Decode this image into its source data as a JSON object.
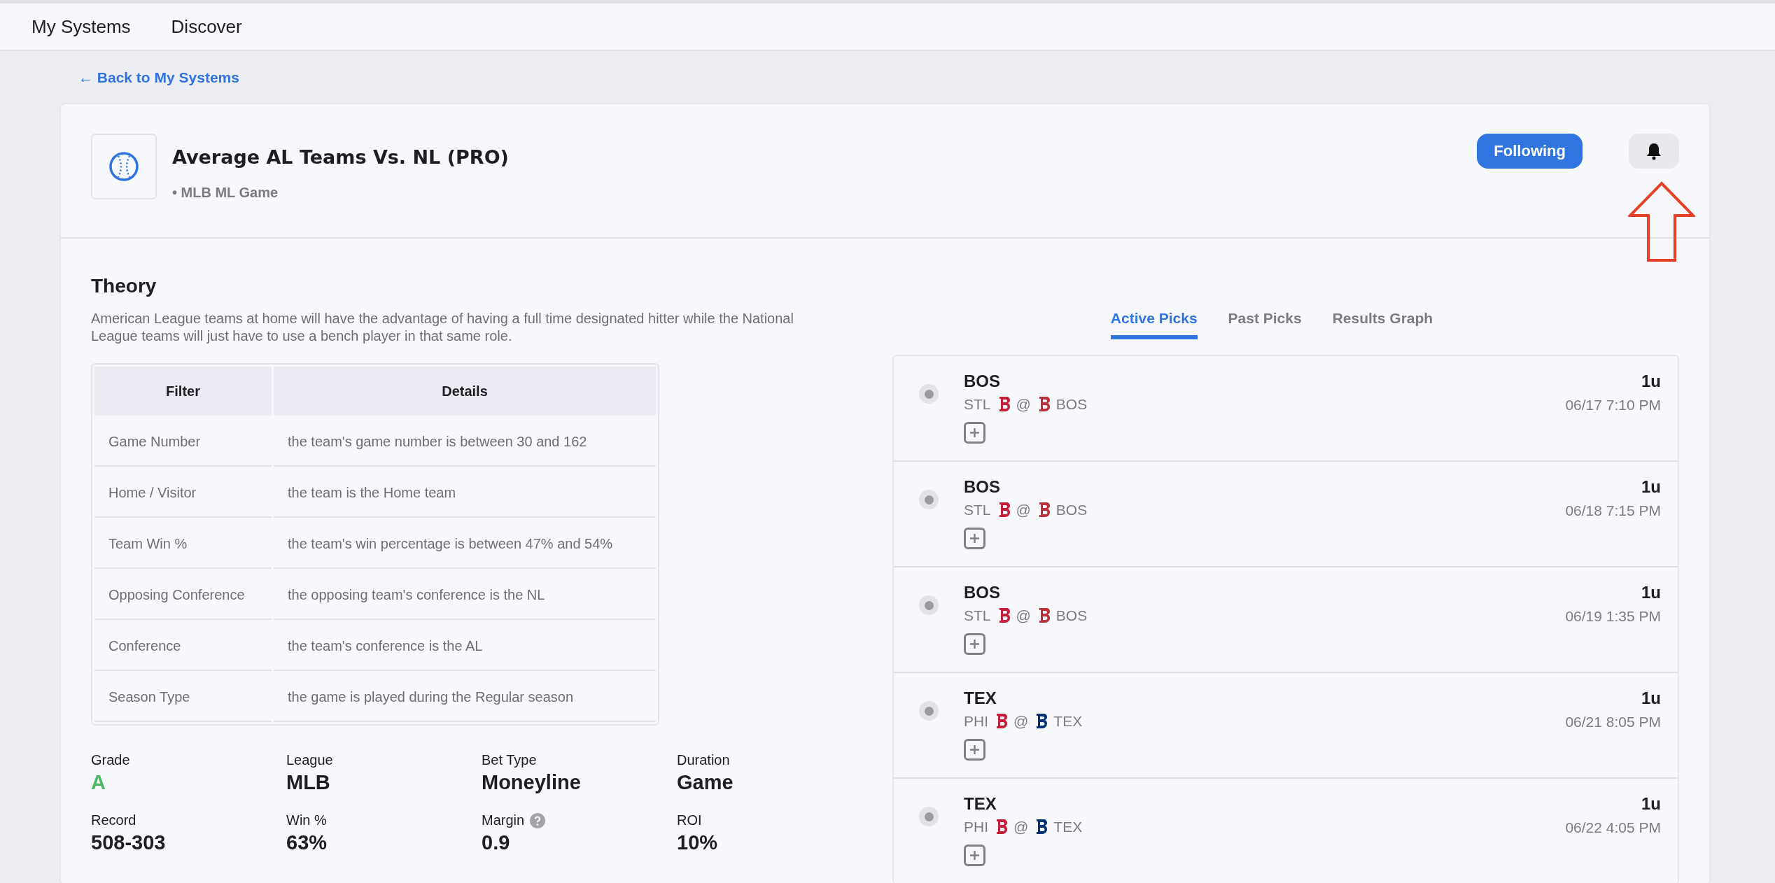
{
  "nav": {
    "items": [
      {
        "label": "My Systems"
      },
      {
        "label": "Discover"
      }
    ]
  },
  "back_link": "← Back to My Systems",
  "system": {
    "title": "Average AL Teams Vs. NL (PRO)",
    "subtitle": "• MLB ML Game",
    "follow_button": "Following",
    "following": true
  },
  "theory": {
    "heading": "Theory",
    "text": "American League teams at home will have the advantage of having a full time designated hitter while the National League teams will just have to use a bench player in that same role.",
    "table": {
      "columns": [
        "Filter",
        "Details"
      ],
      "rows": [
        [
          "Game Number",
          "the team's game number is between 30 and 162"
        ],
        [
          "Home / Visitor",
          "the team is the Home team"
        ],
        [
          "Team Win %",
          "the team's win percentage is between 47% and 54%"
        ],
        [
          "Opposing Conference",
          "the opposing team's conference is the NL"
        ],
        [
          "Conference",
          "the team's conference is the AL"
        ],
        [
          "Season Type",
          "the game is played during the Regular season"
        ]
      ]
    }
  },
  "stats": [
    {
      "label": "Grade",
      "value": "A",
      "kind": "grade"
    },
    {
      "label": "League",
      "value": "MLB",
      "kind": "plain"
    },
    {
      "label": "Bet Type",
      "value": "Moneyline",
      "kind": "plain"
    },
    {
      "label": "Duration",
      "value": "Game",
      "kind": "plain"
    },
    {
      "label": "Record",
      "value": "508-303",
      "kind": "plain"
    },
    {
      "label": "Win %",
      "value": "63%",
      "kind": "plain"
    },
    {
      "label": "Margin",
      "value": "0.9",
      "kind": "help"
    },
    {
      "label": "ROI",
      "value": "10%",
      "kind": "plain"
    }
  ],
  "tabs": [
    {
      "label": "Active Picks",
      "selected": true
    },
    {
      "label": "Past Picks",
      "selected": false
    },
    {
      "label": "Results Graph",
      "selected": false
    }
  ],
  "picks": [
    {
      "team": "BOS",
      "away": {
        "code": "STL",
        "color": "#c41e3a"
      },
      "at": "@",
      "home": {
        "code": "BOS",
        "color": "#bd3039"
      },
      "units": "1u",
      "time": "06/17 7:10 PM"
    },
    {
      "team": "BOS",
      "away": {
        "code": "STL",
        "color": "#c41e3a"
      },
      "at": "@",
      "home": {
        "code": "BOS",
        "color": "#bd3039"
      },
      "units": "1u",
      "time": "06/18 7:15 PM"
    },
    {
      "team": "BOS",
      "away": {
        "code": "STL",
        "color": "#c41e3a"
      },
      "at": "@",
      "home": {
        "code": "BOS",
        "color": "#bd3039"
      },
      "units": "1u",
      "time": "06/19 1:35 PM"
    },
    {
      "team": "TEX",
      "away": {
        "code": "PHI",
        "color": "#c41e3a"
      },
      "at": "@",
      "home": {
        "code": "TEX",
        "color": "#003278"
      },
      "units": "1u",
      "time": "06/21 8:05 PM"
    },
    {
      "team": "TEX",
      "away": {
        "code": "PHI",
        "color": "#c41e3a"
      },
      "at": "@",
      "home": {
        "code": "TEX",
        "color": "#003278"
      },
      "units": "1u",
      "time": "06/22 4:05 PM"
    }
  ]
}
